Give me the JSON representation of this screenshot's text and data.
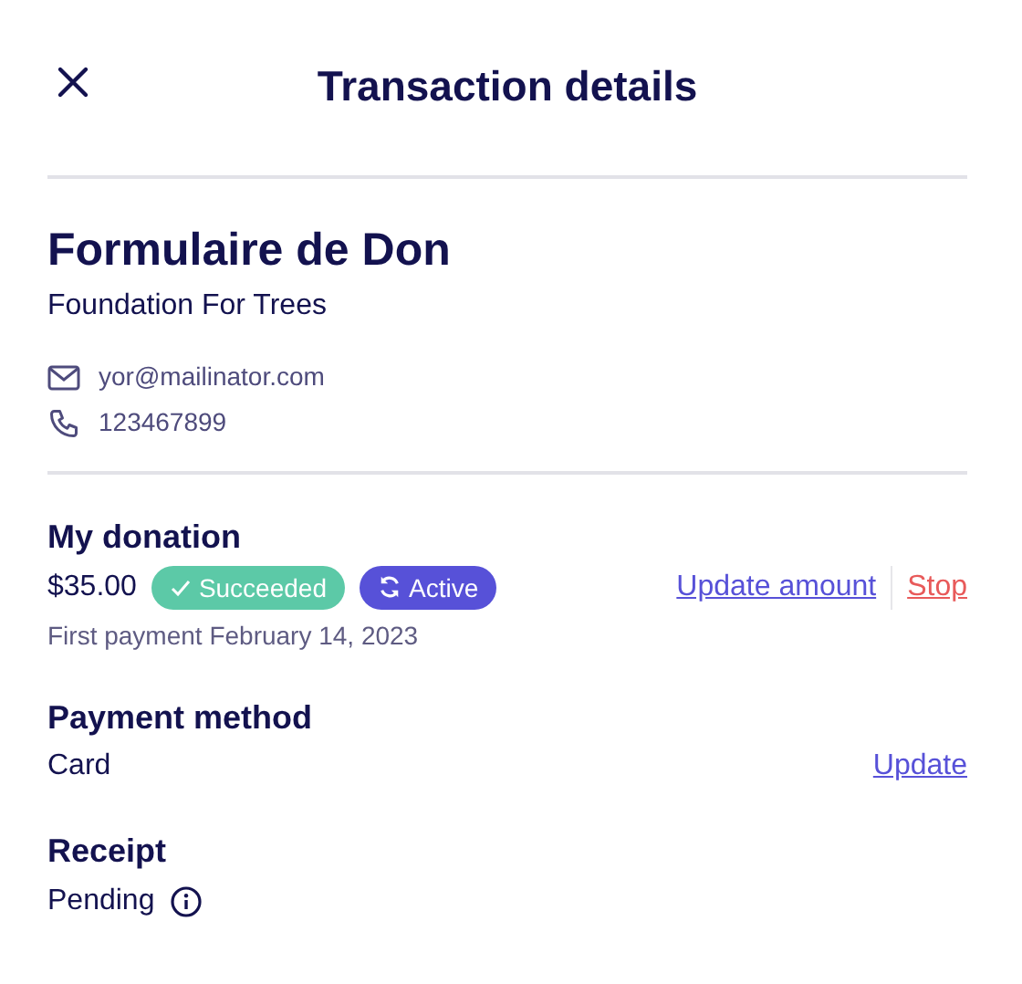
{
  "header": {
    "title": "Transaction details"
  },
  "form": {
    "title": "Formulaire de Don",
    "organization": "Foundation For Trees"
  },
  "contact": [
    {
      "kind": "email",
      "text": "yor@mailinator.com"
    },
    {
      "kind": "phone",
      "text": "123467899"
    }
  ],
  "donation": {
    "heading": "My donation",
    "amount": "$35.00",
    "badges": [
      {
        "kind": "check",
        "label": "Succeeded",
        "color": "#5cc9a7"
      },
      {
        "kind": "recurring",
        "label": "Active",
        "color": "#5751d8"
      }
    ],
    "actions": [
      {
        "kind": "primary",
        "label": "Update amount"
      },
      {
        "kind": "danger",
        "label": "Stop"
      }
    ],
    "note": "First payment February 14, 2023"
  },
  "payment": {
    "heading": "Payment method",
    "value": "Card",
    "action": "Update"
  },
  "receipt": {
    "heading": "Receipt",
    "value": "Pending"
  }
}
